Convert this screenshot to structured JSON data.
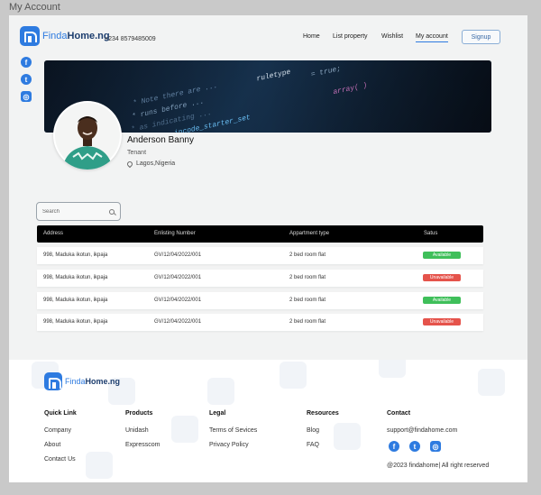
{
  "window": {
    "title": "My Account"
  },
  "header": {
    "brand_prefix": "Finda",
    "brand_suffix": "Home.ng",
    "phone": "+234 8579485009",
    "nav": [
      "Home",
      "List property",
      "Wishlist",
      "My account"
    ],
    "active_nav": "My account",
    "signup_label": "Signup"
  },
  "social_icons": [
    "facebook-icon",
    "twitter-icon",
    "instagram-icon"
  ],
  "profile": {
    "name": "Anderson Banny",
    "role": "Tenant",
    "location": "Lagos,Nigeria"
  },
  "search": {
    "placeholder": "Search",
    "value": ""
  },
  "table": {
    "headers": [
      "Address",
      "Enlisting Number",
      "Appartment type",
      "Satus"
    ],
    "rows": [
      {
        "address": "998, Maduka ikotun, ikpaja",
        "number": "GV/12/04/2022/001",
        "type": "2 bed room flat",
        "status": "Available"
      },
      {
        "address": "998, Maduka ikotun, ikpaja",
        "number": "GV/12/04/2022/001",
        "type": "2 bed room flat",
        "status": "Unavailable"
      },
      {
        "address": "998, Maduka ikotun, ikpaja",
        "number": "GV/12/04/2022/001",
        "type": "2 bed room flat",
        "status": "Available"
      },
      {
        "address": "998, Maduka ikotun, ikpaja",
        "number": "GV/12/04/2022/001",
        "type": "2 bed room flat",
        "status": "Unavailable"
      }
    ]
  },
  "footer": {
    "brand_prefix": "Finda",
    "brand_suffix": "Home.ng",
    "columns": {
      "quick_link": {
        "title": "Quick Link",
        "links": [
          "Company",
          "About",
          "Contact Us"
        ]
      },
      "products": {
        "title": "Products",
        "links": [
          "Unidash",
          "Expresscom"
        ]
      },
      "legal": {
        "title": "Legal",
        "links": [
          "Terms of Sevices",
          "Privacy Policy"
        ]
      },
      "resources": {
        "title": "Resources",
        "links": [
          "Blog",
          "FAQ"
        ]
      },
      "contact": {
        "title": "Contact",
        "email": "support@findahome.com"
      }
    },
    "copyright": "@2023 findahome| All right reserved"
  },
  "colors": {
    "brand": "#2e7be0",
    "available": "#3fbf5a",
    "unavailable": "#e5534b",
    "table_header": "#000000"
  }
}
